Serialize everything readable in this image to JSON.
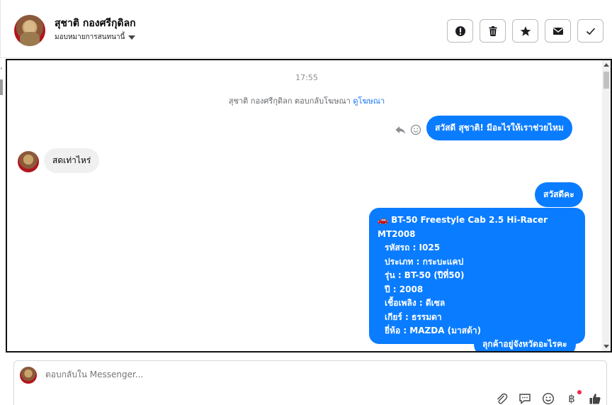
{
  "header": {
    "contact_name": "สุชาติ กองศรีกุดิลก",
    "assign_label": "มอบหมายการสนทนานี้",
    "actions": [
      {
        "name": "spam-button",
        "icon": "alert-icon"
      },
      {
        "name": "delete-button",
        "icon": "trash-icon"
      },
      {
        "name": "star-button",
        "icon": "star-icon"
      },
      {
        "name": "mark-unread-button",
        "icon": "envelope-icon"
      },
      {
        "name": "done-button",
        "icon": "check-icon"
      }
    ]
  },
  "chat": {
    "timestamp": "17:55",
    "reply_note": "สุชาติ กองศรีกุดิลก ตอบกลับโฆษณา",
    "reply_link": "ดูโฆษณา",
    "messages": [
      {
        "from": "page",
        "text": "สวัสดี สุชาติ! มีอะไรให้เราช่วยไหม"
      },
      {
        "from": "user",
        "text": "สดเท่าไหร่"
      },
      {
        "from": "page",
        "text": "สวัสดีคะ"
      },
      {
        "from": "page",
        "text": "ลุกค้าอยู่จังหวัดอะไรคะ"
      }
    ],
    "car_card": {
      "emoji": "🚗",
      "title": "BT-50 Freestyle Cab 2.5 Hi-Racer MT2008",
      "lines": [
        "รหัสรถ : I025",
        "ประเภท : กระบะแคป",
        "รุ่น : BT-50 (ปีที่50)",
        "ปี : 2008",
        "เชื้อเพลิง : ดีเซล",
        "เกียร์ : ธรรมดา",
        "ยี่ห้อ : MAZDA (มาสด้า)"
      ]
    }
  },
  "composer": {
    "placeholder": "ตอบกลับใน Messenger..."
  },
  "colors": {
    "accent": "#0a7cff",
    "link": "#1877f2",
    "incoming_bubble": "#f0f0f0",
    "notification_dot": "#f02849"
  }
}
